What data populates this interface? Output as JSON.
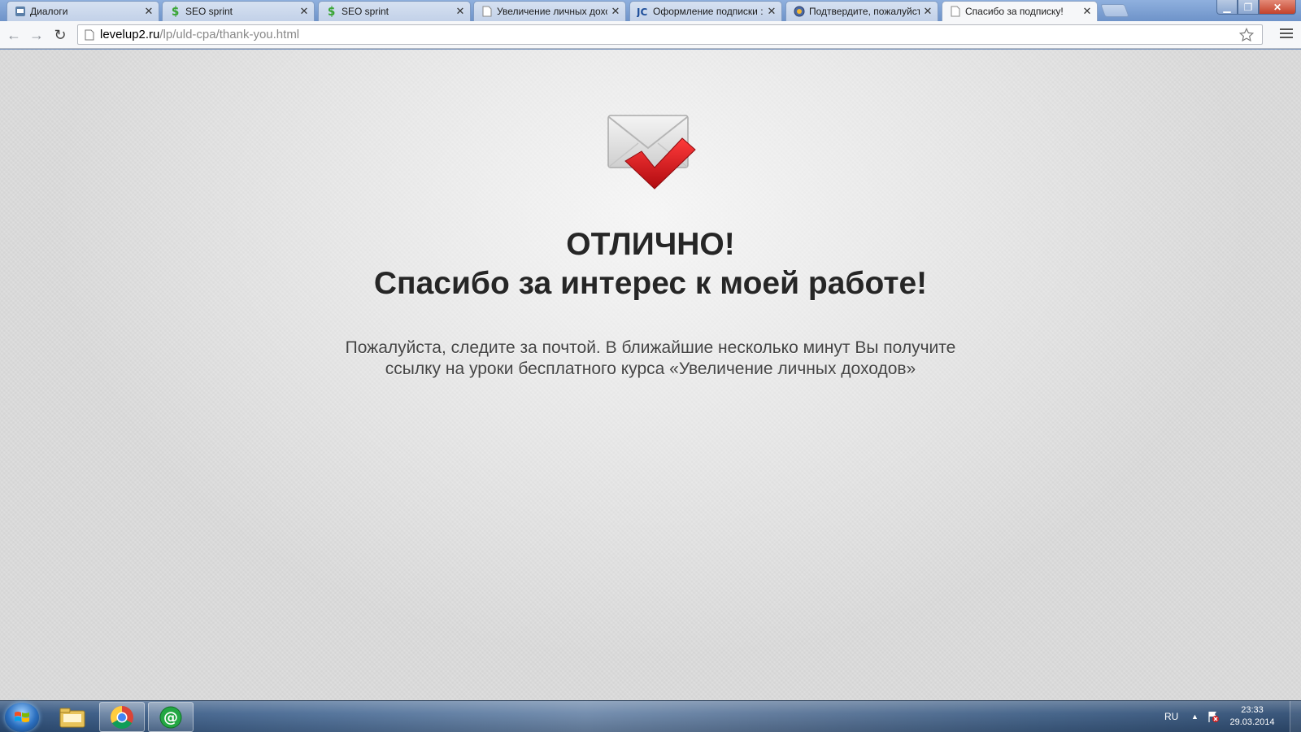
{
  "browser": {
    "tabs": [
      {
        "title": "Диалоги",
        "favicon": "vk-dialogs-icon",
        "active": false
      },
      {
        "title": "SEO sprint",
        "favicon": "seosprint-icon",
        "active": false
      },
      {
        "title": "SEO sprint",
        "favicon": "seosprint-icon",
        "active": false
      },
      {
        "title": "Увеличение личных дохо",
        "favicon": "page-icon",
        "active": false
      },
      {
        "title": "Оформление подписки :",
        "favicon": "justclick-icon",
        "active": false
      },
      {
        "title": "Подтвердите, пожалуйст",
        "favicon": "globe-icon",
        "active": false
      },
      {
        "title": "Спасибо за подписку!",
        "favicon": "page-icon",
        "active": true
      }
    ],
    "url_host": "levelup2.ru",
    "url_path": "/lp/uld-cpa/thank-you.html"
  },
  "page": {
    "headline_1": "ОТЛИЧНО!",
    "headline_2": "Спасибо за интерес к моей работе!",
    "subtext_line_1": "Пожалуйста, следите за почтой. В ближайшие несколько минут Вы получите",
    "subtext_line_2": "ссылку на уроки бесплатного курса «Увеличение личных доходов»",
    "icon": "envelope-checkmark-icon"
  },
  "taskbar": {
    "pinned": [
      "windows-explorer-icon",
      "chrome-icon",
      "mail-agent-icon"
    ],
    "language": "RU",
    "time": "23:33",
    "date": "29.03.2014"
  },
  "colors": {
    "checkmark_red": "#d8141a",
    "page_bg": "#dcdcdc",
    "headline_text": "#262626"
  }
}
